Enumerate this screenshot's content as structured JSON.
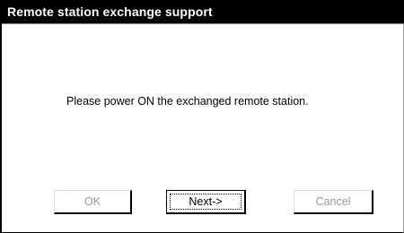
{
  "window": {
    "title": "Remote station exchange support"
  },
  "main": {
    "message": "Please power ON the exchanged remote station."
  },
  "buttons": {
    "ok_label": "OK",
    "next_label": "Next->",
    "cancel_label": "Cancel",
    "ok_enabled": false,
    "next_enabled": true,
    "cancel_enabled": false,
    "focused": "Next->"
  },
  "colors": {
    "titlebar_bg": "#000000",
    "titlebar_text": "#ffffff",
    "disabled_text": "#9a9a9a"
  }
}
